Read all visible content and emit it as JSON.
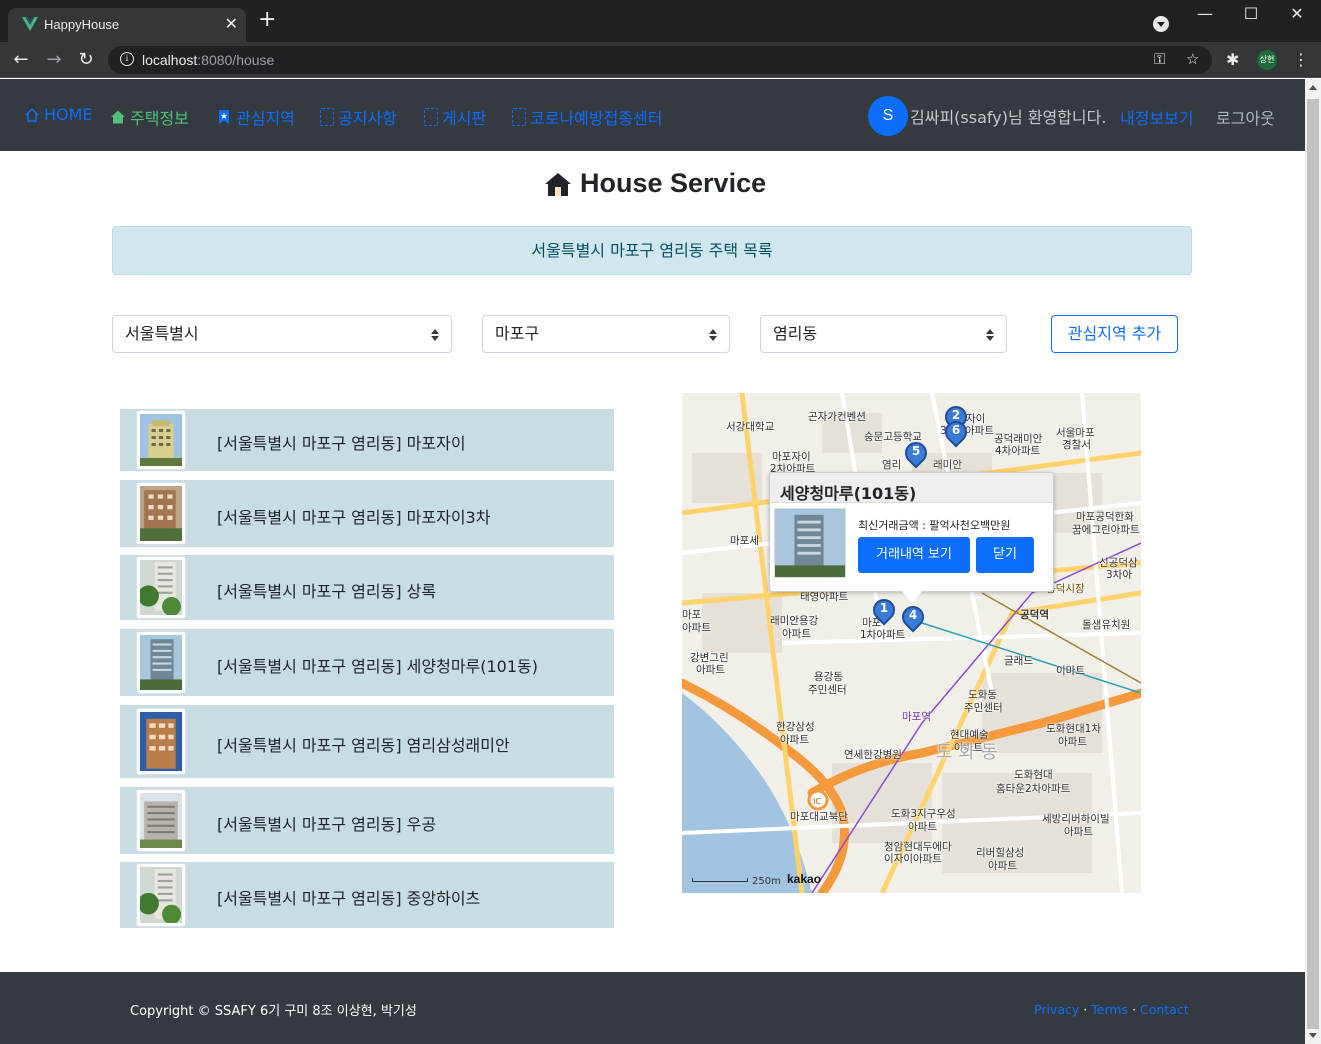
{
  "browser": {
    "tab_title": "HappyHouse",
    "url_host": "localhost",
    "url_path": ":8080/house",
    "profile_initials": "상현"
  },
  "navbar": {
    "home": "HOME",
    "house_info": "주택정보",
    "interest_area": "관심지역",
    "notice": "공지사항",
    "board": "게시판",
    "covid_center": "코로나예방접종센터",
    "user_initial": "S",
    "welcome": "김싸피(ssafy)님 환영합니다.",
    "mypage": "내정보보기",
    "logout": "로그아웃"
  },
  "main": {
    "title": "House Service",
    "alert": "서울특별시 마포구 염리동 주택 목록",
    "select_sido": "서울특별시",
    "select_gugun": "마포구",
    "select_dong": "염리동",
    "add_interest": "관심지역 추가"
  },
  "houses": [
    {
      "name": "[서울특별시 마포구 염리동] 마포자이"
    },
    {
      "name": "[서울특별시 마포구 염리동] 마포자이3차"
    },
    {
      "name": "[서울특별시 마포구 염리동] 상록"
    },
    {
      "name": "[서울특별시 마포구 염리동] 세양청마루(101동)"
    },
    {
      "name": "[서울특별시 마포구 염리동] 염리삼성래미안"
    },
    {
      "name": "[서울특별시 마포구 염리동] 우공"
    },
    {
      "name": "[서울특별시 마포구 염리동] 중앙하이츠"
    }
  ],
  "map": {
    "infowindow": {
      "title": "세양청마루(101동)",
      "price": "최신거래금액 : 팔억사천오백만원",
      "history_button": "거래내역 보기",
      "close_button": "닫기"
    },
    "markers": [
      "1",
      "2",
      "4",
      "5",
      "6"
    ],
    "labels": [
      "서강대학교",
      "곤자가컨벤션",
      "숭문고등학교",
      "마포자이",
      "2차아파트",
      "염리",
      "래미안",
      "공덕래미안",
      "4차아파트",
      "서울마포",
      "경찰서",
      "자이",
      "3",
      "아파트",
      "마포세",
      "마포공덕한화",
      "꿈에그린아파트",
      "신공덕삼",
      "3차아",
      "태영아파트",
      "래미안용강",
      "아파트",
      "마포",
      "1차아파트",
      "공덕역",
      "돌샘유치원",
      "마포",
      "아파트",
      "강변그린",
      "아파트",
      "용강동",
      "주민센터",
      "글래드",
      "이마트",
      "도화동",
      "주민센터",
      "한강삼성",
      "아파트",
      "연세한강병원",
      "현대예술",
      "아파트",
      "도화현대1차",
      "아파트",
      "도화현대",
      "홈타운2차아파트",
      "마포대교북단",
      "도화3지구우성",
      "아파트",
      "세방리버하이빌",
      "아파트",
      "청암현대두에다이자이아파트",
      "리버힐삼성",
      "아파트",
      "공덕시장",
      "마포역",
      "도화동"
    ],
    "scale": "250m",
    "brand": "kakao"
  },
  "footer": {
    "copyright": "Copyright © SSAFY 6기 구미 8조 이상현, 박기성",
    "privacy": "Privacy",
    "terms": "Terms",
    "contact": "Contact",
    "sep": "·"
  },
  "colors": {
    "navbar_bg": "#343a40",
    "link_blue": "#0d6efd",
    "active_green": "#4ec07a",
    "list_bg": "#c8dde3",
    "alert_bg": "#d1e7ee"
  }
}
